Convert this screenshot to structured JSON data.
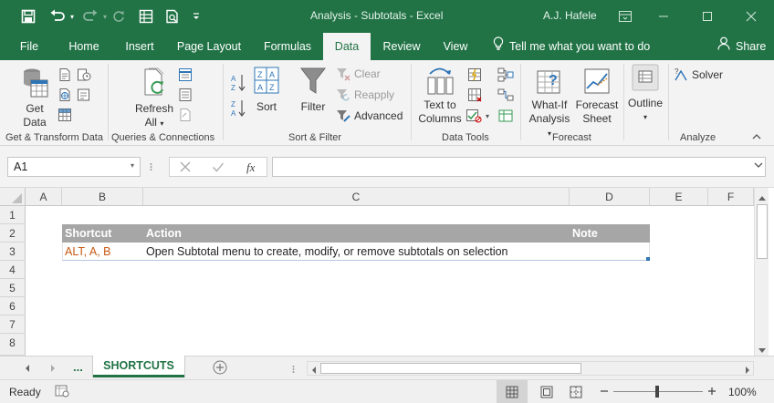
{
  "titlebar": {
    "doc_title": "Analysis - Subtotals  -  Excel",
    "user": "A.J. Hafele"
  },
  "tabs": [
    {
      "label": "File"
    },
    {
      "label": "Home"
    },
    {
      "label": "Insert"
    },
    {
      "label": "Page Layout"
    },
    {
      "label": "Formulas"
    },
    {
      "label": "Data"
    },
    {
      "label": "Review"
    },
    {
      "label": "View"
    }
  ],
  "tell_me": "Tell me what you want to do",
  "share": "Share",
  "ribbon": {
    "get_data": "Get",
    "get_data2": "Data",
    "refresh": "Refresh",
    "refresh2": "All",
    "sort_label": "Sort",
    "filter_label": "Filter",
    "clear_label": "Clear",
    "reapply_label": "Reapply",
    "advanced_label": "Advanced",
    "text_to_columns": "Text to",
    "text_to_columns2": "Columns",
    "what_if": "What-If",
    "what_if2": "Analysis",
    "forecast": "Forecast",
    "forecast2": "Sheet",
    "outline": "Outline",
    "solver": "Solver",
    "groups": {
      "get_transform": "Get & Transform Data",
      "queries": "Queries & Connections",
      "sort_filter": "Sort & Filter",
      "data_tools": "Data Tools",
      "forecast": "Forecast",
      "analyze": "Analyze"
    }
  },
  "formula_bar": {
    "name_box": "A1",
    "fx": "fx",
    "formula": ""
  },
  "grid": {
    "columns": [
      "A",
      "B",
      "C",
      "D",
      "E",
      "F"
    ],
    "rows": [
      "1",
      "2",
      "3",
      "4",
      "5",
      "6",
      "7",
      "8"
    ],
    "table": {
      "headers": [
        "Shortcut",
        "Action",
        "Note"
      ],
      "rows": [
        {
          "shortcut": "ALT, A, B",
          "action": "Open Subtotal menu to create, modify, or remove subtotals on selection",
          "note": ""
        }
      ]
    }
  },
  "sheets": {
    "ellipsis": "...",
    "active": "SHORTCUTS"
  },
  "status": {
    "ready": "Ready",
    "zoom": "100%"
  },
  "colors": {
    "excel_green": "#217346",
    "table_header": "#a6a6a6",
    "shortcut_text": "#c65911"
  }
}
